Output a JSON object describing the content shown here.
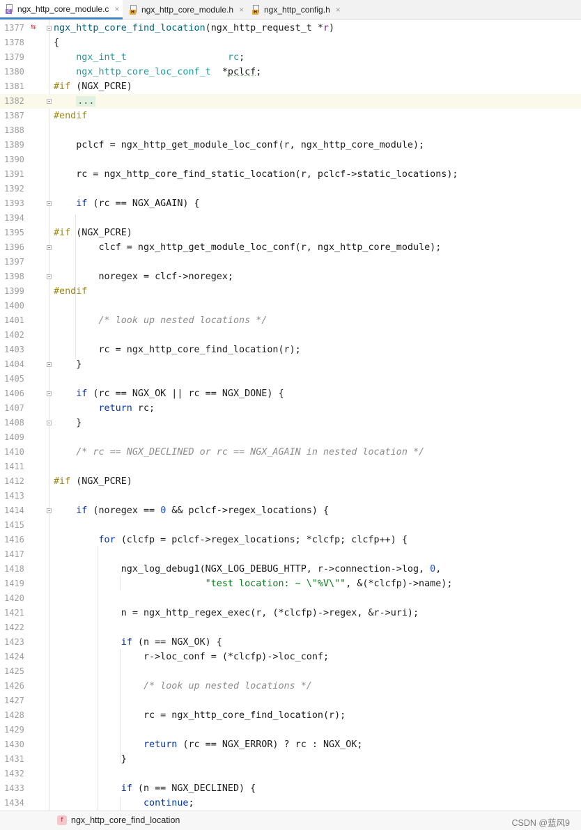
{
  "tabs": [
    {
      "label": "ngx_http_core_module.c",
      "icon": "c-file-icon",
      "active": true
    },
    {
      "label": "ngx_http_core_module.h",
      "icon": "h-file-icon",
      "active": false
    },
    {
      "label": "ngx_http_config.h",
      "icon": "h-file-icon",
      "active": false
    }
  ],
  "close_glyph": "×",
  "colors": {
    "accent": "#4083c9",
    "keyword": "#0033b3",
    "function": "#00627a",
    "comment": "#8c8c8c",
    "string": "#067d17",
    "number": "#1750eb",
    "preprocessor": "#9e880d",
    "current_line": "#fbfaea"
  },
  "lines": [
    {
      "n": "1377",
      "mark": "⇆",
      "fold": true,
      "segs": [
        [
          "fn",
          "ngx_http_core_find_location"
        ],
        [
          "",
          "(ngx_http_request_t *"
        ],
        [
          "va",
          "r"
        ],
        [
          "",
          ")"
        ]
      ]
    },
    {
      "n": "1378",
      "segs": [
        [
          "",
          "{"
        ]
      ]
    },
    {
      "n": "1379",
      "segs": [
        [
          "",
          "    "
        ],
        [
          "ty",
          "ngx_int_t"
        ],
        [
          "",
          "                  "
        ],
        [
          "ty",
          "rc"
        ],
        [
          "",
          ";"
        ]
      ]
    },
    {
      "n": "1380",
      "segs": [
        [
          "",
          "    "
        ],
        [
          "ty",
          "ngx_http_core_loc_conf_t"
        ],
        [
          "",
          "  *"
        ],
        [
          "ul",
          "pclcf"
        ],
        [
          "",
          ";"
        ]
      ]
    },
    {
      "n": "1381",
      "segs": [
        [
          "pp",
          "#if"
        ],
        [
          "",
          " (NGX_PCRE)"
        ]
      ]
    },
    {
      "n": "1382",
      "fold": true,
      "hl": true,
      "segs": [
        [
          "",
          "    "
        ],
        [
          "fb",
          "..."
        ]
      ]
    },
    {
      "n": "1387",
      "segs": [
        [
          "pp",
          "#endif"
        ]
      ]
    },
    {
      "n": "1388",
      "segs": []
    },
    {
      "n": "1389",
      "segs": [
        [
          "",
          "    pclcf = ngx_http_get_module_loc_conf(r, ngx_http_core_module);"
        ]
      ]
    },
    {
      "n": "1390",
      "segs": []
    },
    {
      "n": "1391",
      "segs": [
        [
          "",
          "    rc = ngx_http_core_find_static_location(r, pclcf->static_locations);"
        ]
      ]
    },
    {
      "n": "1392",
      "segs": []
    },
    {
      "n": "1393",
      "fold": true,
      "segs": [
        [
          "",
          "    "
        ],
        [
          "kw",
          "if"
        ],
        [
          "",
          " (rc == NGX_AGAIN) {"
        ]
      ]
    },
    {
      "n": "1394",
      "segs": []
    },
    {
      "n": "1395",
      "segs": [
        [
          "pp",
          "#if"
        ],
        [
          "",
          " (NGX_PCRE)"
        ]
      ]
    },
    {
      "n": "1396",
      "fold": true,
      "segs": [
        [
          "",
          "        clcf = ngx_http_get_module_loc_conf(r, ngx_http_core_module);"
        ]
      ]
    },
    {
      "n": "1397",
      "segs": []
    },
    {
      "n": "1398",
      "fold": true,
      "segs": [
        [
          "",
          "        noregex = clcf->noregex;"
        ]
      ]
    },
    {
      "n": "1399",
      "segs": [
        [
          "pp",
          "#endif"
        ]
      ]
    },
    {
      "n": "1400",
      "segs": []
    },
    {
      "n": "1401",
      "segs": [
        [
          "",
          "        "
        ],
        [
          "cm",
          "/* look up nested locations */"
        ]
      ]
    },
    {
      "n": "1402",
      "segs": []
    },
    {
      "n": "1403",
      "segs": [
        [
          "",
          "        rc = ngx_http_core_find_location(r);"
        ]
      ]
    },
    {
      "n": "1404",
      "fold": true,
      "segs": [
        [
          "",
          "    }"
        ]
      ]
    },
    {
      "n": "1405",
      "segs": []
    },
    {
      "n": "1406",
      "fold": true,
      "segs": [
        [
          "",
          "    "
        ],
        [
          "kw",
          "if"
        ],
        [
          "",
          " (rc == NGX_OK || rc == NGX_DONE) {"
        ]
      ]
    },
    {
      "n": "1407",
      "segs": [
        [
          "",
          "        "
        ],
        [
          "kw",
          "return"
        ],
        [
          "",
          " rc;"
        ]
      ]
    },
    {
      "n": "1408",
      "fold": true,
      "segs": [
        [
          "",
          "    }"
        ]
      ]
    },
    {
      "n": "1409",
      "segs": []
    },
    {
      "n": "1410",
      "segs": [
        [
          "",
          "    "
        ],
        [
          "cm",
          "/* rc == NGX_DECLINED or rc == NGX_AGAIN in nested location */"
        ]
      ]
    },
    {
      "n": "1411",
      "segs": []
    },
    {
      "n": "1412",
      "segs": [
        [
          "pp",
          "#if"
        ],
        [
          "",
          " (NGX_PCRE)"
        ]
      ]
    },
    {
      "n": "1413",
      "segs": []
    },
    {
      "n": "1414",
      "fold": true,
      "segs": [
        [
          "",
          "    "
        ],
        [
          "kw",
          "if"
        ],
        [
          "",
          " (noregex == "
        ],
        [
          "nm",
          "0"
        ],
        [
          "",
          " && pclcf->regex_locations) {"
        ]
      ]
    },
    {
      "n": "1415",
      "segs": []
    },
    {
      "n": "1416",
      "segs": [
        [
          "",
          "        "
        ],
        [
          "kw",
          "for"
        ],
        [
          "",
          " (clcfp = pclcf->regex_locations; *clcfp; clcfp++) {"
        ]
      ]
    },
    {
      "n": "1417",
      "segs": []
    },
    {
      "n": "1418",
      "segs": [
        [
          "",
          "            ngx_log_debug1(NGX_LOG_DEBUG_HTTP, r->connection->log, "
        ],
        [
          "nm",
          "0"
        ],
        [
          "",
          ","
        ]
      ]
    },
    {
      "n": "1419",
      "segs": [
        [
          "",
          "                           "
        ],
        [
          "st",
          "\"test location: ~ \\\"%V\\\"\""
        ],
        [
          "",
          ", &(*clcfp)->name);"
        ]
      ]
    },
    {
      "n": "1420",
      "segs": []
    },
    {
      "n": "1421",
      "segs": [
        [
          "",
          "            n = ngx_http_regex_exec(r, (*clcfp)->regex, &r->uri);"
        ]
      ]
    },
    {
      "n": "1422",
      "segs": []
    },
    {
      "n": "1423",
      "segs": [
        [
          "",
          "            "
        ],
        [
          "kw",
          "if"
        ],
        [
          "",
          " (n == NGX_OK) {"
        ]
      ]
    },
    {
      "n": "1424",
      "segs": [
        [
          "",
          "                r->loc_conf = (*clcfp)->loc_conf;"
        ]
      ]
    },
    {
      "n": "1425",
      "segs": []
    },
    {
      "n": "1426",
      "segs": [
        [
          "",
          "                "
        ],
        [
          "cm",
          "/* look up nested locations */"
        ]
      ]
    },
    {
      "n": "1427",
      "segs": []
    },
    {
      "n": "1428",
      "segs": [
        [
          "",
          "                rc = ngx_http_core_find_location(r);"
        ]
      ]
    },
    {
      "n": "1429",
      "segs": []
    },
    {
      "n": "1430",
      "segs": [
        [
          "",
          "                "
        ],
        [
          "kw",
          "return"
        ],
        [
          "",
          " (rc == NGX_ERROR) ? rc : NGX_OK;"
        ]
      ]
    },
    {
      "n": "1431",
      "segs": [
        [
          "",
          "            }"
        ]
      ]
    },
    {
      "n": "1432",
      "segs": []
    },
    {
      "n": "1433",
      "segs": [
        [
          "",
          "            "
        ],
        [
          "kw",
          "if"
        ],
        [
          "",
          " (n == NGX_DECLINED) {"
        ]
      ]
    },
    {
      "n": "1434",
      "segs": [
        [
          "",
          "                "
        ],
        [
          "kw",
          "continue"
        ],
        [
          "",
          ";"
        ]
      ]
    }
  ],
  "breadcrumb": {
    "icon_letter": "f",
    "label": "ngx_http_core_find_location"
  },
  "watermark": "CSDN @蓝风9"
}
